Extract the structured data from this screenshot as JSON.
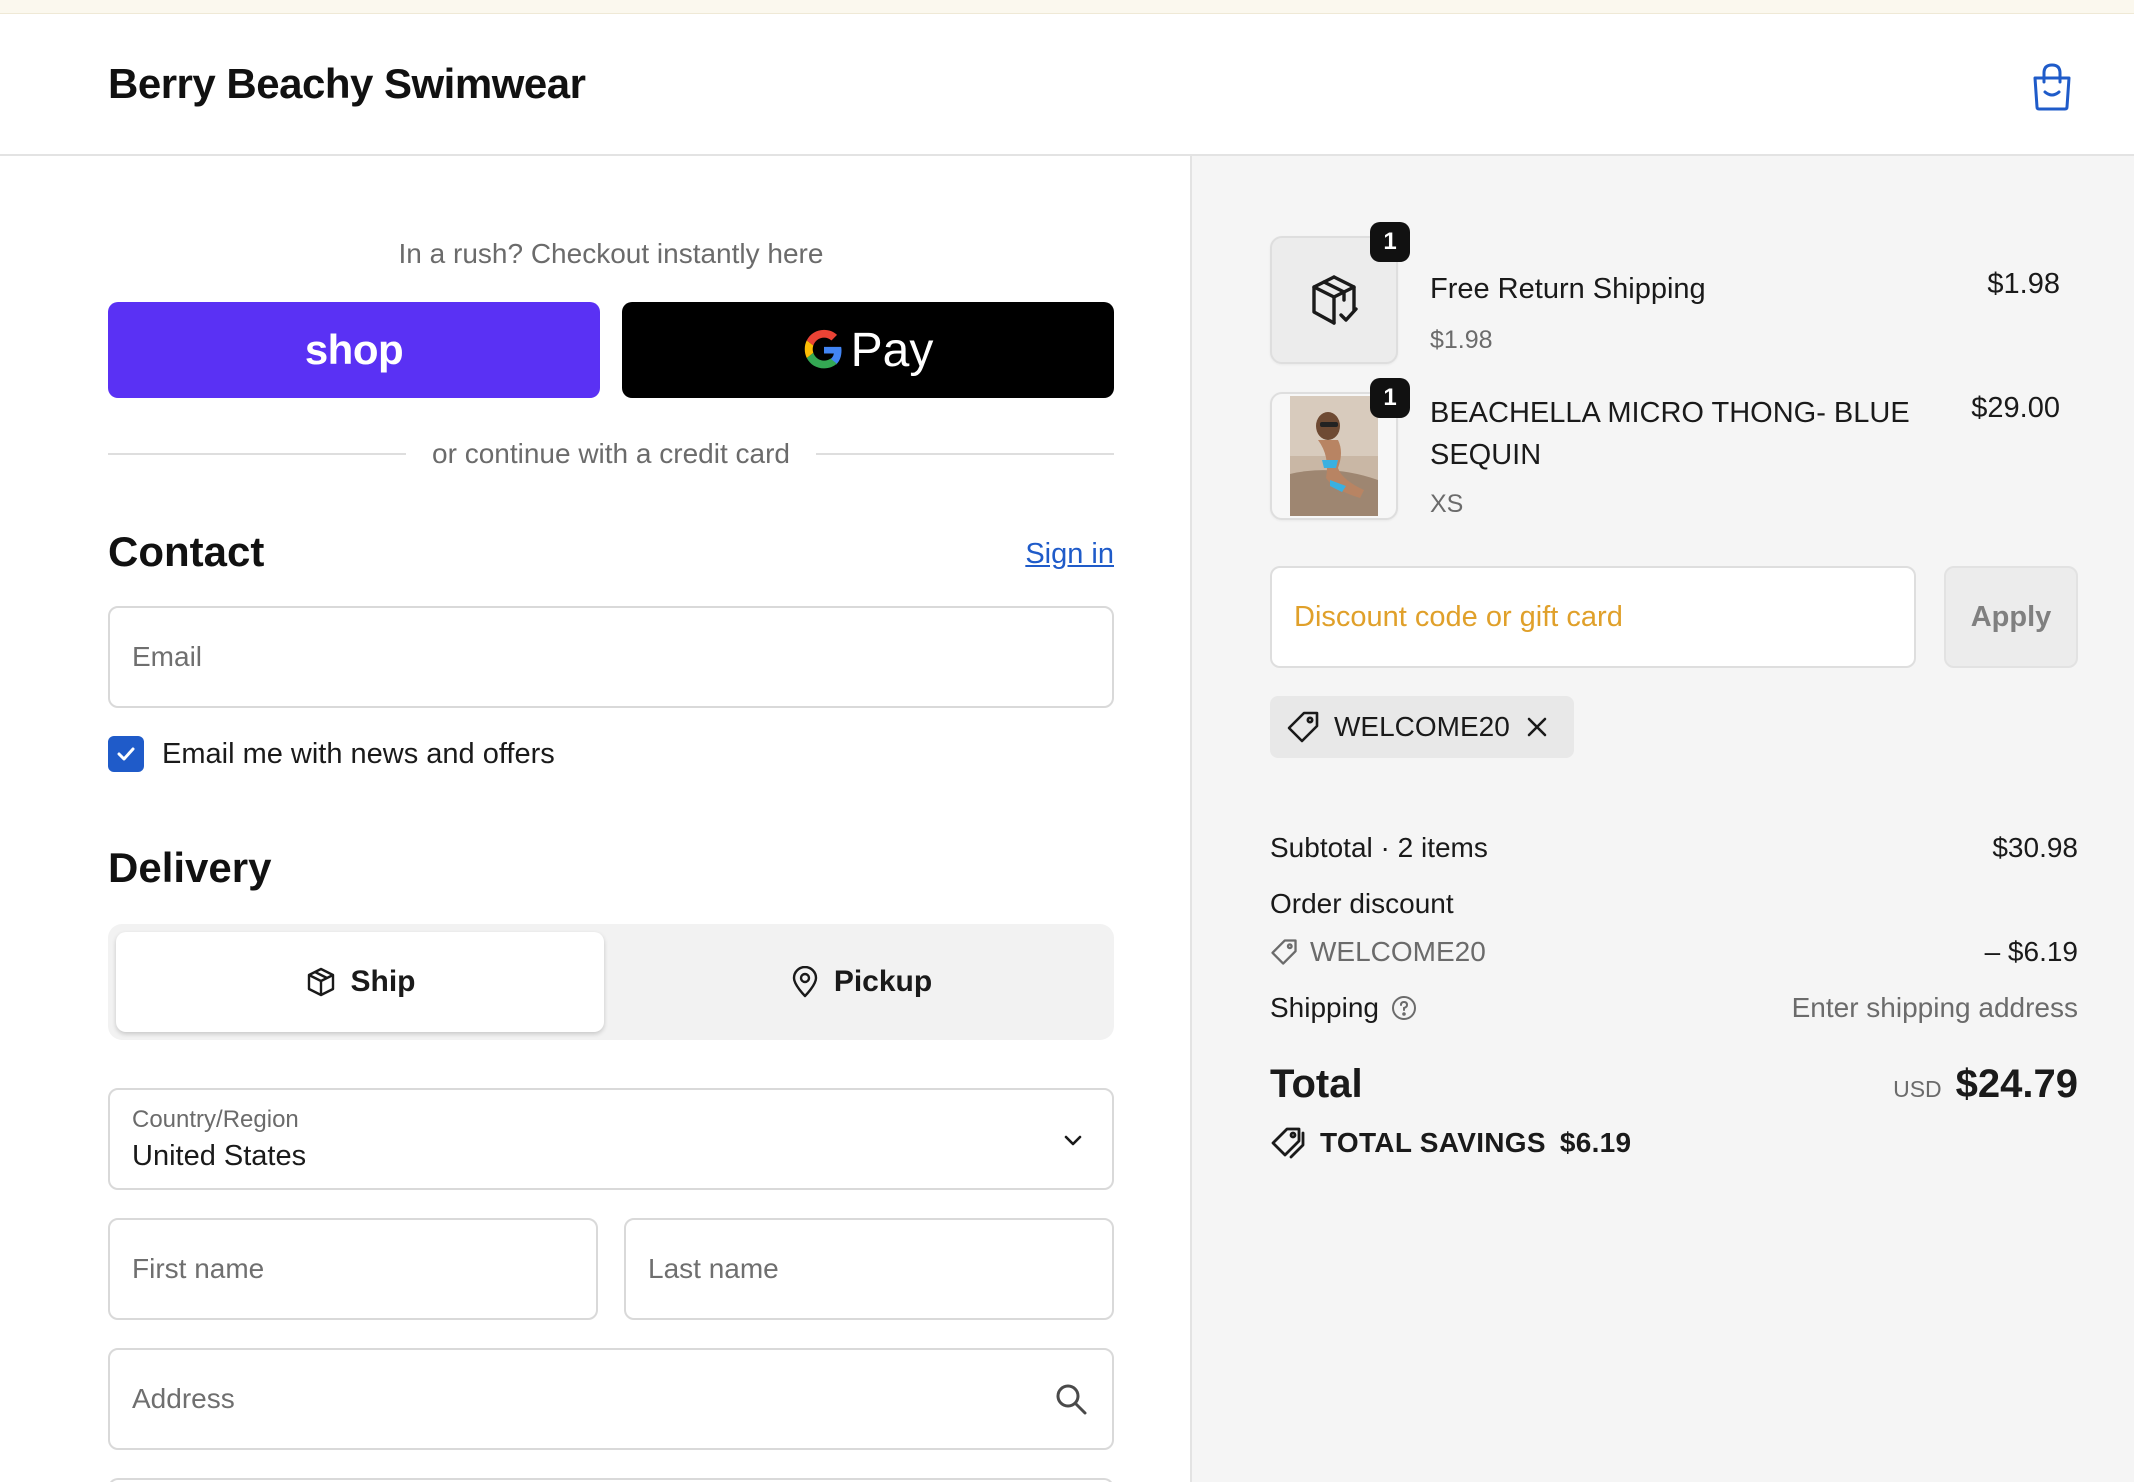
{
  "header": {
    "store_name": "Berry Beachy Swimwear"
  },
  "express": {
    "prompt": "In a rush? Checkout instantly here",
    "shop_label": "shop",
    "gpay_label": "Pay",
    "divider_text": "or continue with a credit card"
  },
  "contact": {
    "heading": "Contact",
    "signin_label": "Sign in",
    "email_placeholder": "Email",
    "newsletter_label": "Email me with news and offers",
    "newsletter_checked": true
  },
  "delivery": {
    "heading": "Delivery",
    "ship_label": "Ship",
    "pickup_label": "Pickup",
    "country_label": "Country/Region",
    "country_value": "United States",
    "first_name_placeholder": "First name",
    "last_name_placeholder": "Last name",
    "address_placeholder": "Address"
  },
  "order": {
    "items": [
      {
        "title": "Free Return Shipping",
        "subtitle": "$1.98",
        "price": "$1.98",
        "quantity": "1"
      },
      {
        "title": "BEACHELLA MICRO THONG- BLUE SEQUIN",
        "subtitle": "XS",
        "price": "$29.00",
        "quantity": "1"
      }
    ],
    "discount_placeholder": "Discount code or gift card",
    "apply_label": "Apply",
    "applied_code": "WELCOME20",
    "subtotal_label": "Subtotal · 2 items",
    "subtotal_value": "$30.98",
    "order_discount_label": "Order discount",
    "discount_code": "WELCOME20",
    "discount_value": "– $6.19",
    "shipping_label": "Shipping",
    "shipping_value": "Enter shipping address",
    "total_label": "Total",
    "total_currency": "USD",
    "total_value": "$24.79",
    "savings_label": "TOTAL SAVINGS",
    "savings_value": "$6.19"
  },
  "colors": {
    "shop_pay": "#5a31f4",
    "link": "#1f5bc9",
    "discount_placeholder": "#e0a02a"
  }
}
